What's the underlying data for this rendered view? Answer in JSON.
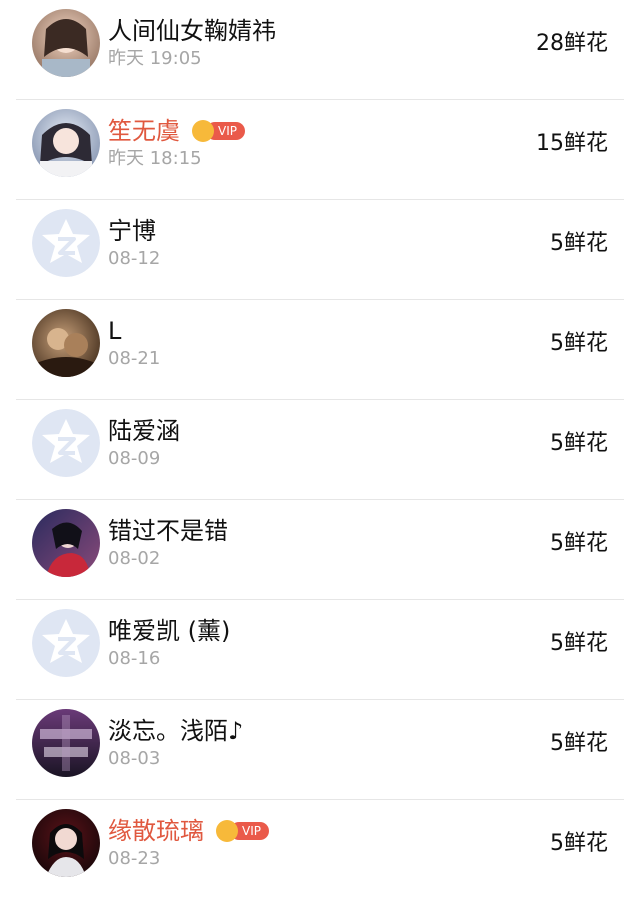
{
  "colors": {
    "name": "#111111",
    "vip_name": "#e0583f",
    "time": "#a6a6a6",
    "separator": "#e6e6e6",
    "vip_badge": "#ea5a4a",
    "crown": "#f7b93a",
    "default_avatar": "#dfe6f3"
  },
  "vip_label": "VIP",
  "gifts": [
    {
      "name": "人间仙女鞠婧祎",
      "time": "昨天 19:05",
      "amount": "28鲜花",
      "vip": false,
      "avatar": "photo"
    },
    {
      "name": "笙无虞",
      "time": "昨天 18:15",
      "amount": "15鲜花",
      "vip": true,
      "avatar": "photo"
    },
    {
      "name": "宁博",
      "time": "08-12",
      "amount": "5鲜花",
      "vip": false,
      "avatar": "default-avatar-icon"
    },
    {
      "name": "L",
      "time": "08-21",
      "amount": "5鲜花",
      "vip": false,
      "avatar": "photo"
    },
    {
      "name": "陆爱涵",
      "time": "08-09",
      "amount": "5鲜花",
      "vip": false,
      "avatar": "default-avatar-icon"
    },
    {
      "name": "错过不是错",
      "time": "08-02",
      "amount": "5鲜花",
      "vip": false,
      "avatar": "photo"
    },
    {
      "name": "唯爱凯 (薰)",
      "time": "08-16",
      "amount": "5鲜花",
      "vip": false,
      "avatar": "default-avatar-icon"
    },
    {
      "name": "淡忘。浅陌♪",
      "time": "08-03",
      "amount": "5鲜花",
      "vip": false,
      "avatar": "photo"
    },
    {
      "name": "缘散琉璃",
      "time": "08-23",
      "amount": "5鲜花",
      "vip": true,
      "avatar": "photo"
    }
  ]
}
